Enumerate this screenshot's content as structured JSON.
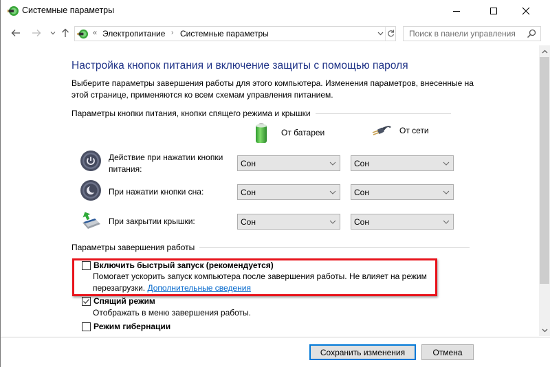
{
  "window": {
    "title": "Системные параметры",
    "controls": {
      "minimize": "minimize",
      "maximize": "maximize",
      "close": "close"
    }
  },
  "nav": {
    "breadcrumb_prefix": "«",
    "breadcrumbs": [
      "Электропитание",
      "Системные параметры"
    ],
    "breadcrumb_separator": "›",
    "search_placeholder": "Поиск в панели управления"
  },
  "page": {
    "title": "Настройка кнопок питания и включение защиты с помощью пароля",
    "intro": "Выберите параметры завершения работы для этого компьютера. Изменения параметров, внесенные на этой странице, применяются ко всем схемам управления питанием.",
    "power_section": {
      "heading": "Параметры кнопки питания, кнопки спящего режима и крышки",
      "columns": [
        {
          "label": "От батареи",
          "icon": "battery-icon"
        },
        {
          "label": "От сети",
          "icon": "power-plug-icon"
        }
      ],
      "rows": [
        {
          "label": "Действие при нажатии кнопки питания:",
          "icon": "power-button-icon",
          "battery": "Сон",
          "ac": "Сон"
        },
        {
          "label": "При нажатии кнопки сна:",
          "icon": "sleep-button-icon",
          "battery": "Сон",
          "ac": "Сон"
        },
        {
          "label": "При закрытии крышки:",
          "icon": "laptop-lid-icon",
          "battery": "Сон",
          "ac": "Сон"
        }
      ]
    },
    "shutdown_section": {
      "heading": "Параметры завершения работы",
      "options": [
        {
          "label": "Включить быстрый запуск (рекомендуется)",
          "checked": false,
          "description": "Помогает ускорить запуск компьютера после завершения работы. Не влияет на режим перезагрузки.",
          "link": "Дополнительные сведения",
          "highlighted": true
        },
        {
          "label": "Спящий режим",
          "checked": true,
          "description": "Отображать в меню завершения работы."
        },
        {
          "label": "Режим гибернации",
          "checked": false
        }
      ]
    }
  },
  "footer": {
    "save": "Сохранить изменения",
    "cancel": "Отмена"
  },
  "colors": {
    "title_blue": "#1e3287",
    "link_blue": "#0066cc",
    "highlight_red": "#e8141c",
    "focus_blue": "#0078d7"
  }
}
